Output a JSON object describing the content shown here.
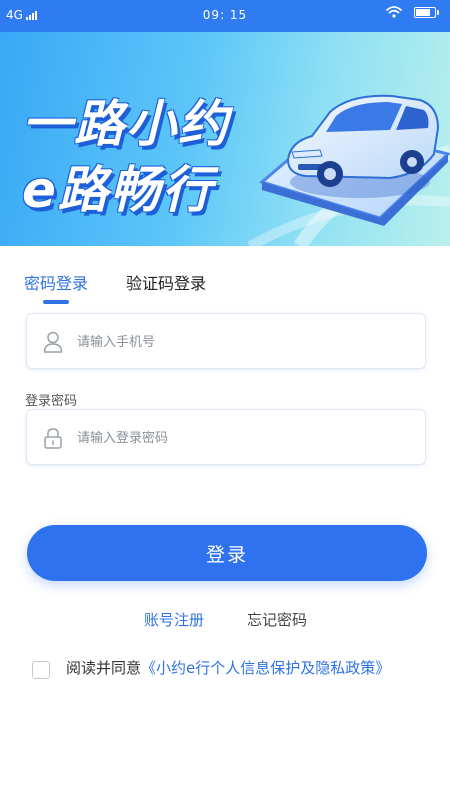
{
  "status_bar": {
    "network": "4G",
    "time": "09: 15",
    "battery_level": 0.85
  },
  "banner": {
    "line1": "一路小约",
    "line2": "e路畅行"
  },
  "tabs": {
    "password_login": "密码登录",
    "code_login": "验证码登录"
  },
  "form": {
    "phone_placeholder": "请输入手机号",
    "password_label": "登录密码",
    "password_placeholder": "请输入登录密码",
    "login_button": "登录"
  },
  "links": {
    "register": "账号注册",
    "forgot_password": "忘记密码"
  },
  "agreement": {
    "prefix": "阅读并同意",
    "policy_link": "《小约e行个人信息保护及隐私政策》"
  },
  "colors": {
    "accent": "#2f72f0",
    "status_bar": "#2f7bf2"
  }
}
